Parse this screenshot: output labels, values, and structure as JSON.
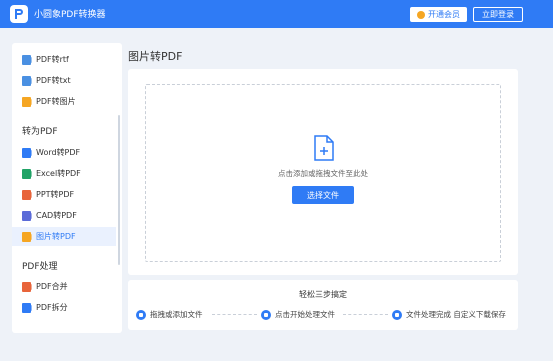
{
  "header": {
    "app_title": "小圆象PDF转换器",
    "vip_label": "开通会员",
    "login_label": "立即登录"
  },
  "sidebar": {
    "items_top": [
      {
        "label": "PDF转rtf",
        "icon": "rtf-file-icon",
        "color": "#4a90e2"
      },
      {
        "label": "PDF转txt",
        "icon": "txt-file-icon",
        "color": "#4a90e2"
      },
      {
        "label": "PDF转图片",
        "icon": "image-file-icon",
        "color": "#f5a623"
      }
    ],
    "group_to_pdf": "转为PDF",
    "items_to_pdf": [
      {
        "label": "Word转PDF",
        "icon": "word-file-icon",
        "color": "#2f7bf5"
      },
      {
        "label": "Excel转PDF",
        "icon": "excel-file-icon",
        "color": "#21a366"
      },
      {
        "label": "PPT转PDF",
        "icon": "ppt-file-icon",
        "color": "#e8643a"
      },
      {
        "label": "CAD转PDF",
        "icon": "cad-file-icon",
        "color": "#5b6bd8"
      },
      {
        "label": "图片转PDF",
        "icon": "image-file-icon",
        "color": "#f5a623",
        "active": true
      }
    ],
    "group_pdf_process": "PDF处理",
    "items_process": [
      {
        "label": "PDF合并",
        "icon": "merge-file-icon",
        "color": "#e8643a"
      },
      {
        "label": "PDF拆分",
        "icon": "split-file-icon",
        "color": "#2f7bf5"
      }
    ]
  },
  "main": {
    "page_title": "图片转PDF",
    "drop_hint": "点击添加或拖拽文件至此处",
    "choose_button": "选择文件",
    "steps_title": "轻松三步搞定",
    "steps": [
      {
        "label": "拖拽或添加文件",
        "icon": "add-file-icon"
      },
      {
        "label": "点击开始处理文件",
        "icon": "process-icon"
      },
      {
        "label": "文件处理完成 自定义下载保存",
        "icon": "download-icon"
      }
    ]
  },
  "colors": {
    "accent": "#2f7bf5",
    "background": "#eef2f8",
    "panel": "#ffffff"
  }
}
